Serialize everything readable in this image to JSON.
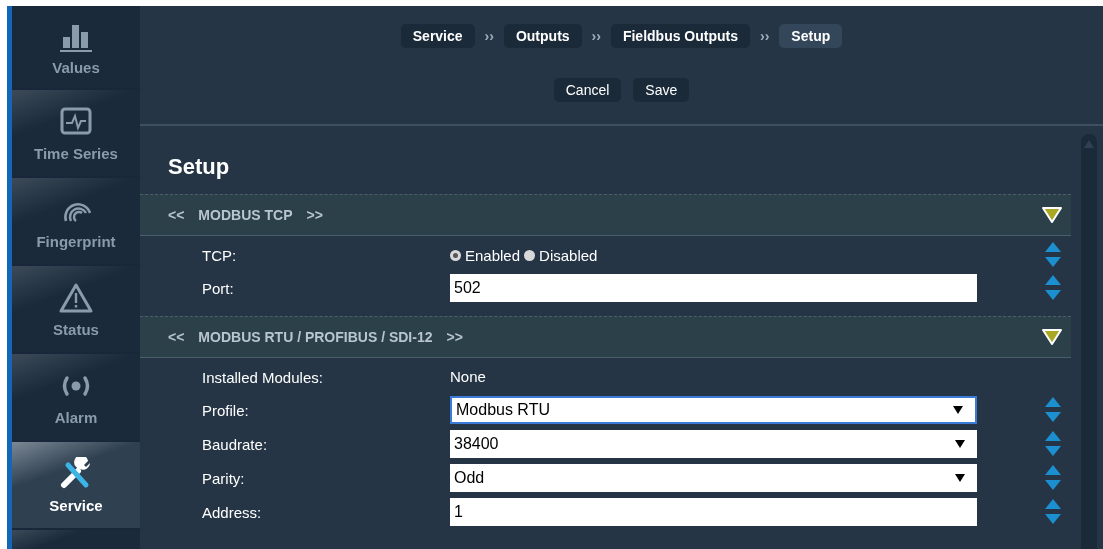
{
  "sidebar": {
    "items": [
      {
        "label": "Values",
        "selected": false
      },
      {
        "label": "Time Series",
        "selected": false
      },
      {
        "label": "Fingerprint",
        "selected": false
      },
      {
        "label": "Status",
        "selected": false
      },
      {
        "label": "Alarm",
        "selected": false
      },
      {
        "label": "Service",
        "selected": true
      }
    ]
  },
  "breadcrumb": [
    {
      "label": "Service",
      "selected": false
    },
    {
      "label": "Outputs",
      "selected": false
    },
    {
      "label": "Fieldbus Outputs",
      "selected": false
    },
    {
      "label": "Setup",
      "selected": true
    }
  ],
  "breadcrumb_separator": "››",
  "actions": [
    "Cancel",
    "Save"
  ],
  "page_title": "Setup",
  "sections": [
    {
      "prev": "<<",
      "title": "MODBUS TCP",
      "next": ">>",
      "rows": [
        {
          "kind": "radio",
          "label": "TCP:",
          "options": [
            {
              "label": "Enabled",
              "selected": true
            },
            {
              "label": "Disabled",
              "selected": false
            }
          ]
        },
        {
          "kind": "input",
          "label": "Port:",
          "value": "502"
        }
      ]
    },
    {
      "prev": "<<",
      "title": "MODBUS RTU / PROFIBUS / SDI-12",
      "next": ">>",
      "rows": [
        {
          "kind": "text",
          "label": "Installed Modules:",
          "value": "None"
        },
        {
          "kind": "select",
          "label": "Profile:",
          "value": "Modbus RTU",
          "focused": true
        },
        {
          "kind": "select",
          "label": "Baudrate:",
          "value": "38400",
          "focused": false
        },
        {
          "kind": "select",
          "label": "Parity:",
          "value": "Odd",
          "focused": false
        },
        {
          "kind": "input",
          "label": "Address:",
          "value": "1"
        }
      ]
    }
  ]
}
